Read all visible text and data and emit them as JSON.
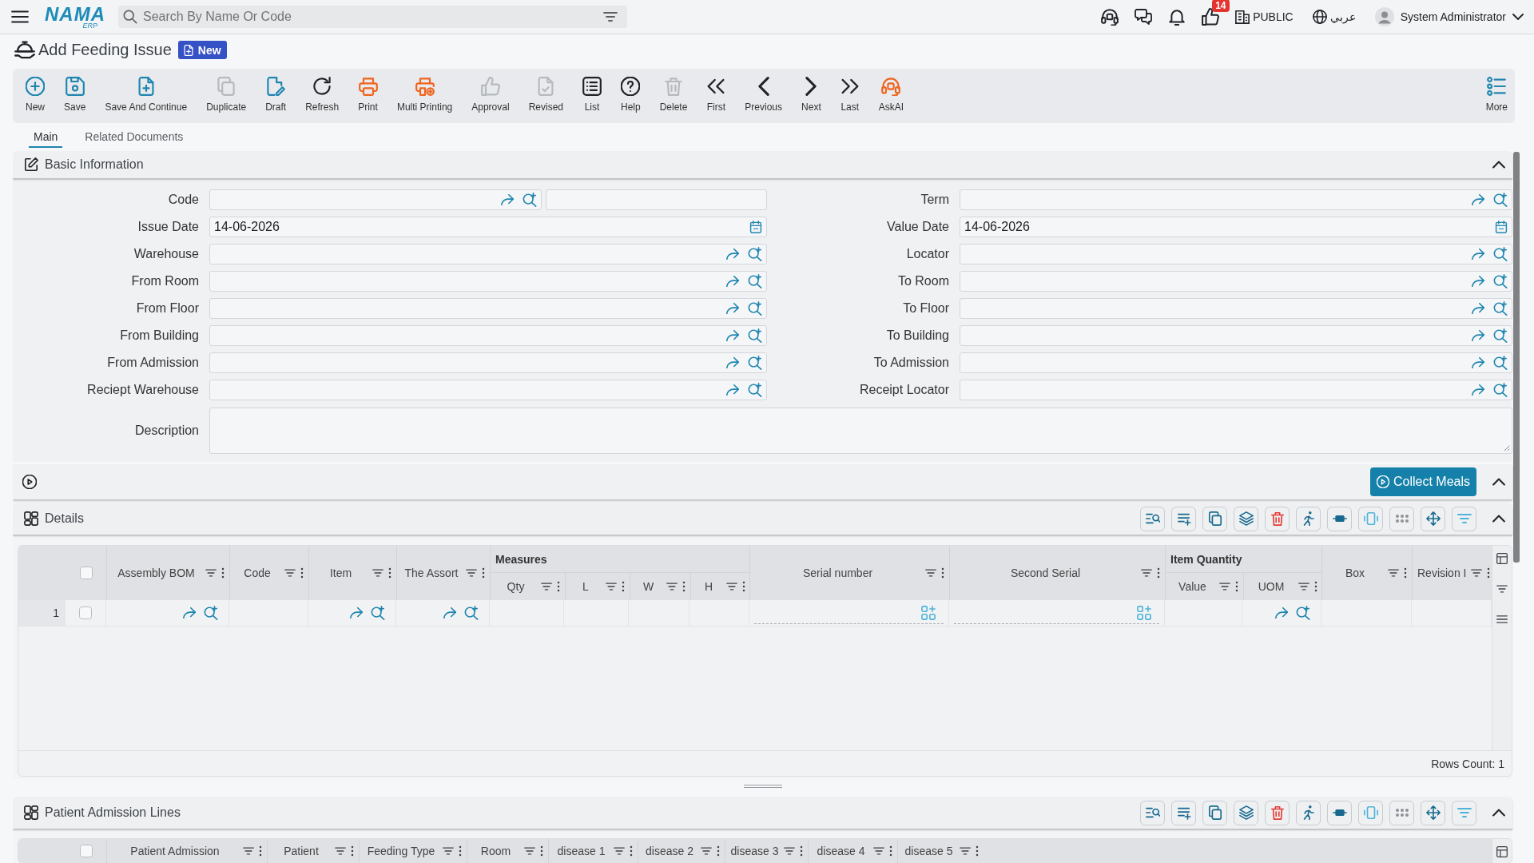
{
  "top_bar": {
    "logo": {
      "name": "NAMA",
      "sub": "ERP"
    },
    "search": {
      "placeholder": "Search By Name Or Code"
    },
    "notification_count": "14",
    "branch": "PUBLIC",
    "language": "عربي",
    "user": "System Administrator"
  },
  "page": {
    "title": "Add Feeding Issue",
    "status": "New"
  },
  "toolbar": {
    "items": [
      {
        "label": "New",
        "kind": "new",
        "disabled": false
      },
      {
        "label": "Save",
        "kind": "save",
        "disabled": false
      },
      {
        "label": "Save And Continue",
        "kind": "continue",
        "disabled": false
      },
      {
        "label": "Duplicate",
        "kind": "duplicate",
        "disabled": true
      },
      {
        "label": "Draft",
        "kind": "draft",
        "disabled": false
      },
      {
        "label": "Refresh",
        "kind": "refresh",
        "disabled": false
      },
      {
        "label": "Print",
        "kind": "print",
        "disabled": false
      },
      {
        "label": "Multi Printing",
        "kind": "multiprint",
        "disabled": false
      },
      {
        "label": "Approval",
        "kind": "approval",
        "disabled": true
      },
      {
        "label": "Revised",
        "kind": "revised",
        "disabled": true
      },
      {
        "label": "List",
        "kind": "list",
        "disabled": false
      },
      {
        "label": "Help",
        "kind": "help",
        "disabled": false
      },
      {
        "label": "Delete",
        "kind": "delete",
        "disabled": true
      },
      {
        "label": "First",
        "kind": "first",
        "disabled": false
      },
      {
        "label": "Previous",
        "kind": "previous",
        "disabled": false
      },
      {
        "label": "Next",
        "kind": "next",
        "disabled": false
      },
      {
        "label": "Last",
        "kind": "last",
        "disabled": false
      },
      {
        "label": "AskAI",
        "kind": "ai",
        "disabled": false
      }
    ],
    "more": "More"
  },
  "tabs": [
    {
      "label": "Main",
      "selected": true
    },
    {
      "label": "Related Documents",
      "selected": false
    }
  ],
  "basic_information": {
    "title": "Basic Information",
    "expanded": true,
    "fields": [
      {
        "label": "Code",
        "kind": "code"
      },
      {
        "label": "Term",
        "kind": "lookup"
      },
      {
        "label": "Issue Date",
        "kind": "date",
        "value": "14-06-2026"
      },
      {
        "label": "Value Date",
        "kind": "date",
        "value": "14-06-2026"
      },
      {
        "label": "Warehouse",
        "kind": "lookup"
      },
      {
        "label": "Locator",
        "kind": "lookup"
      },
      {
        "label": "From Room",
        "kind": "lookup"
      },
      {
        "label": "To Room",
        "kind": "lookup"
      },
      {
        "label": "From Floor",
        "kind": "lookup"
      },
      {
        "label": "To Floor",
        "kind": "lookup"
      },
      {
        "label": "From Building",
        "kind": "lookup"
      },
      {
        "label": "To Building",
        "kind": "lookup"
      },
      {
        "label": "From Admission",
        "kind": "lookup"
      },
      {
        "label": "To Admission",
        "kind": "lookup"
      },
      {
        "label": "Reciept Warehouse",
        "kind": "lookup"
      },
      {
        "label": "Receipt Locator",
        "kind": "lookup"
      }
    ],
    "description": {
      "label": "Description"
    }
  },
  "collect_bar": {
    "button": "Collect Meals",
    "expanded": true
  },
  "details": {
    "title": "Details",
    "expanded": true,
    "grid": {
      "select_all": {
        "checked": false
      },
      "columns": [
        {
          "label": "Assembly BOM",
          "kind": "lookup"
        },
        {
          "label": "Code",
          "kind": "text"
        },
        {
          "label": "Item",
          "kind": "lookup"
        },
        {
          "label": "The Assort",
          "kind": "lookup"
        },
        {
          "group": "Measures",
          "children": [
            {
              "label": "Qty",
              "kind": "text"
            },
            {
              "label": "L",
              "kind": "text"
            },
            {
              "label": "W",
              "kind": "text"
            },
            {
              "label": "H",
              "kind": "text"
            }
          ]
        },
        {
          "label": "Serial number",
          "kind": "serial"
        },
        {
          "label": "Second Serial",
          "kind": "serial"
        },
        {
          "group": "Item Quantity",
          "children": [
            {
              "label": "Value",
              "kind": "text"
            },
            {
              "label": "UOM",
              "kind": "lookup"
            }
          ]
        },
        {
          "label": "Box",
          "kind": "text"
        },
        {
          "label": "Revision I",
          "kind": "text"
        }
      ],
      "rows": [
        {
          "number": "1",
          "checked": false
        }
      ],
      "rows_count": "Rows Count: 1"
    }
  },
  "patient_admission_lines": {
    "title": "Patient Admission Lines",
    "expanded": true,
    "grid": {
      "select_all": {
        "checked": false
      },
      "columns": [
        {
          "label": "Patient Admission"
        },
        {
          "label": "Patient"
        },
        {
          "label": "Feeding Type"
        },
        {
          "label": "Room"
        },
        {
          "label": "disease 1"
        },
        {
          "label": "disease 2"
        },
        {
          "label": "disease 3"
        },
        {
          "label": "disease 4"
        },
        {
          "label": "disease 5"
        }
      ]
    }
  }
}
